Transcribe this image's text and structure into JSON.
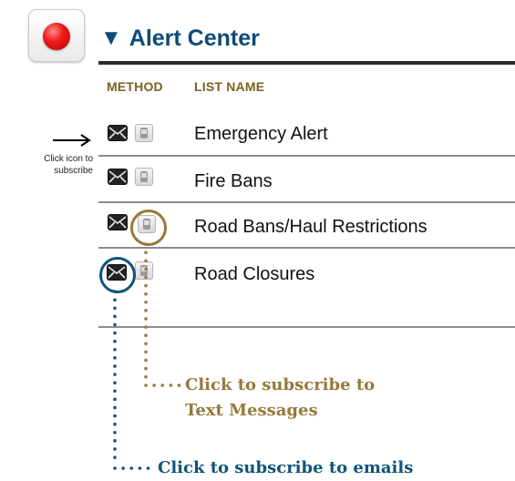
{
  "header": {
    "title": "Alert Center",
    "collapse_glyph": "▼",
    "alert_icon": "red-alert-icon"
  },
  "columns": {
    "method": "METHOD",
    "list_name": "LIST NAME"
  },
  "rows": [
    {
      "name": "Emergency Alert"
    },
    {
      "name": "Fire Bans"
    },
    {
      "name": "Road Bans/Haul Restrictions"
    },
    {
      "name": "Road Closures"
    }
  ],
  "side_note": {
    "line1": "Click icon to",
    "line2": "subscribe"
  },
  "callouts": {
    "text_line1": "Click to subscribe to",
    "text_line2": "Text Messages",
    "email": "Click to subscribe to emails"
  },
  "colors": {
    "title_blue": "#0d4a78",
    "gold": "#96793a",
    "teal_blue": "#0f5478"
  }
}
